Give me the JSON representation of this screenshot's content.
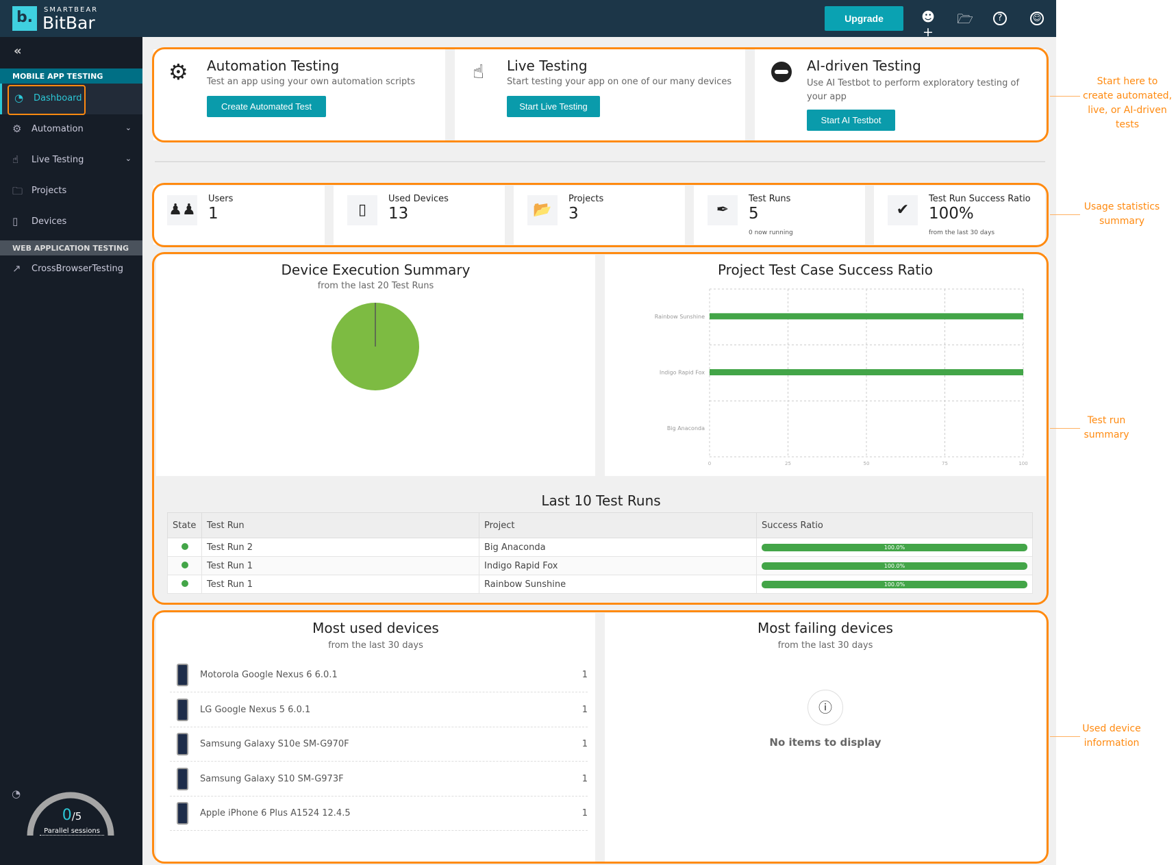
{
  "header": {
    "brand_small": "SMARTBEAR",
    "brand": "BitBar",
    "logo": "b.",
    "upgrade": "Upgrade",
    "icons": [
      "add-user-icon",
      "folder-icon",
      "help-icon",
      "account-icon"
    ]
  },
  "sidebar": {
    "collapse": "«",
    "section_mobile": "MOBILE APP TESTING",
    "section_web": "WEB APPLICATION TESTING",
    "items": [
      {
        "label": "Dashboard",
        "icon": "dashboard-icon"
      },
      {
        "label": "Automation",
        "icon": "gears-icon"
      },
      {
        "label": "Live Testing",
        "icon": "hand-icon"
      },
      {
        "label": "Projects",
        "icon": "folder-icon"
      },
      {
        "label": "Devices",
        "icon": "device-icon"
      },
      {
        "label": "CrossBrowserTesting",
        "icon": "external-icon"
      }
    ],
    "sessions": {
      "used": "0",
      "total": "/5",
      "label": "Parallel sessions"
    }
  },
  "start": [
    {
      "title": "Automation Testing",
      "desc": "Test an app using your own automation scripts",
      "button": "Create Automated Test"
    },
    {
      "title": "Live Testing",
      "desc": "Start testing your app on one of our many devices",
      "button": "Start Live Testing"
    },
    {
      "title": "AI-driven Testing",
      "desc": "Use AI Testbot to perform exploratory testing of your app",
      "button": "Start AI Testbot"
    }
  ],
  "stats": [
    {
      "label": "Users",
      "value": "1",
      "sub": ""
    },
    {
      "label": "Used Devices",
      "value": "13",
      "sub": ""
    },
    {
      "label": "Projects",
      "value": "3",
      "sub": ""
    },
    {
      "label": "Test Runs",
      "value": "5",
      "sub": "0 now running"
    },
    {
      "label": "Test Run Success Ratio",
      "value": "100%",
      "sub": "from the last 30 days"
    }
  ],
  "chart_data": [
    {
      "type": "pie",
      "title": "Device Execution Summary",
      "subtitle": "from the last 20 Test Runs",
      "values": [
        100
      ],
      "colors": [
        "#7dbb42"
      ]
    },
    {
      "type": "bar",
      "orientation": "horizontal",
      "title": "Project Test Case Success Ratio",
      "categories": [
        "Rainbow Sunshine",
        "Indigo Rapid Fox",
        "Big Anaconda"
      ],
      "values": [
        100,
        100,
        0
      ],
      "xlim": [
        0,
        100
      ],
      "xticks": [
        "0",
        "25",
        "50",
        "75",
        "100"
      ],
      "grid": true,
      "color": "#43a548"
    }
  ],
  "runs": {
    "title": "Last 10 Test Runs",
    "headers": [
      "State",
      "Test Run",
      "Project",
      "Success Ratio"
    ],
    "rows": [
      {
        "run": "Test Run 2",
        "project": "Big Anaconda",
        "ratio": "100.0%"
      },
      {
        "run": "Test Run 1",
        "project": "Indigo Rapid Fox",
        "ratio": "100.0%"
      },
      {
        "run": "Test Run 1",
        "project": "Rainbow Sunshine",
        "ratio": "100.0%"
      }
    ]
  },
  "most_used": {
    "title": "Most used devices",
    "sub": "from the last 30 days",
    "items": [
      {
        "name": "Motorola Google Nexus 6 6.0.1",
        "count": "1"
      },
      {
        "name": "LG Google Nexus 5 6.0.1",
        "count": "1"
      },
      {
        "name": "Samsung Galaxy S10e SM-G970F",
        "count": "1"
      },
      {
        "name": "Samsung Galaxy S10 SM-G973F",
        "count": "1"
      },
      {
        "name": "Apple iPhone 6 Plus A1524 12.4.5",
        "count": "1"
      }
    ]
  },
  "most_failing": {
    "title": "Most failing devices",
    "sub": "from the last 30 days",
    "empty": "No items to display"
  },
  "annotations": [
    "Start here to create automated, live, or AI-driven tests",
    "Usage statistics summary",
    "Test run summary",
    "Used device information"
  ]
}
